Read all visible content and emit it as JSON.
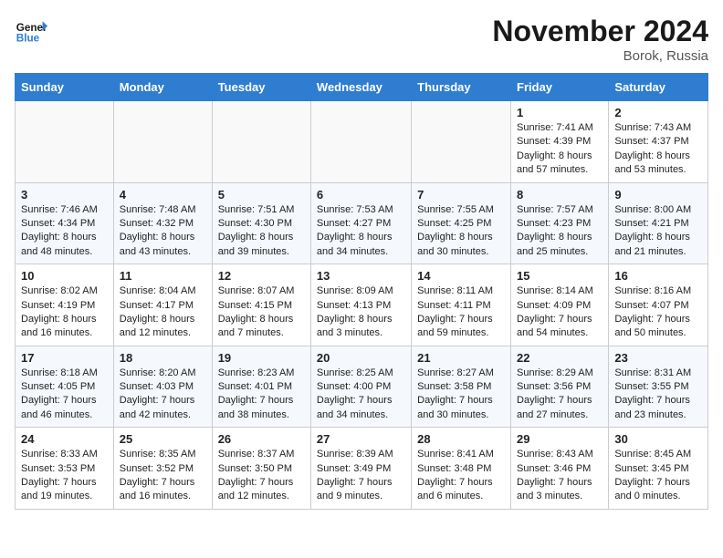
{
  "header": {
    "logo_general": "General",
    "logo_blue": "Blue",
    "month_title": "November 2024",
    "location": "Borok, Russia"
  },
  "days_of_week": [
    "Sunday",
    "Monday",
    "Tuesday",
    "Wednesday",
    "Thursday",
    "Friday",
    "Saturday"
  ],
  "weeks": [
    [
      {
        "day": "",
        "info": ""
      },
      {
        "day": "",
        "info": ""
      },
      {
        "day": "",
        "info": ""
      },
      {
        "day": "",
        "info": ""
      },
      {
        "day": "",
        "info": ""
      },
      {
        "day": "1",
        "info": "Sunrise: 7:41 AM\nSunset: 4:39 PM\nDaylight: 8 hours and 57 minutes."
      },
      {
        "day": "2",
        "info": "Sunrise: 7:43 AM\nSunset: 4:37 PM\nDaylight: 8 hours and 53 minutes."
      }
    ],
    [
      {
        "day": "3",
        "info": "Sunrise: 7:46 AM\nSunset: 4:34 PM\nDaylight: 8 hours and 48 minutes."
      },
      {
        "day": "4",
        "info": "Sunrise: 7:48 AM\nSunset: 4:32 PM\nDaylight: 8 hours and 43 minutes."
      },
      {
        "day": "5",
        "info": "Sunrise: 7:51 AM\nSunset: 4:30 PM\nDaylight: 8 hours and 39 minutes."
      },
      {
        "day": "6",
        "info": "Sunrise: 7:53 AM\nSunset: 4:27 PM\nDaylight: 8 hours and 34 minutes."
      },
      {
        "day": "7",
        "info": "Sunrise: 7:55 AM\nSunset: 4:25 PM\nDaylight: 8 hours and 30 minutes."
      },
      {
        "day": "8",
        "info": "Sunrise: 7:57 AM\nSunset: 4:23 PM\nDaylight: 8 hours and 25 minutes."
      },
      {
        "day": "9",
        "info": "Sunrise: 8:00 AM\nSunset: 4:21 PM\nDaylight: 8 hours and 21 minutes."
      }
    ],
    [
      {
        "day": "10",
        "info": "Sunrise: 8:02 AM\nSunset: 4:19 PM\nDaylight: 8 hours and 16 minutes."
      },
      {
        "day": "11",
        "info": "Sunrise: 8:04 AM\nSunset: 4:17 PM\nDaylight: 8 hours and 12 minutes."
      },
      {
        "day": "12",
        "info": "Sunrise: 8:07 AM\nSunset: 4:15 PM\nDaylight: 8 hours and 7 minutes."
      },
      {
        "day": "13",
        "info": "Sunrise: 8:09 AM\nSunset: 4:13 PM\nDaylight: 8 hours and 3 minutes."
      },
      {
        "day": "14",
        "info": "Sunrise: 8:11 AM\nSunset: 4:11 PM\nDaylight: 7 hours and 59 minutes."
      },
      {
        "day": "15",
        "info": "Sunrise: 8:14 AM\nSunset: 4:09 PM\nDaylight: 7 hours and 54 minutes."
      },
      {
        "day": "16",
        "info": "Sunrise: 8:16 AM\nSunset: 4:07 PM\nDaylight: 7 hours and 50 minutes."
      }
    ],
    [
      {
        "day": "17",
        "info": "Sunrise: 8:18 AM\nSunset: 4:05 PM\nDaylight: 7 hours and 46 minutes."
      },
      {
        "day": "18",
        "info": "Sunrise: 8:20 AM\nSunset: 4:03 PM\nDaylight: 7 hours and 42 minutes."
      },
      {
        "day": "19",
        "info": "Sunrise: 8:23 AM\nSunset: 4:01 PM\nDaylight: 7 hours and 38 minutes."
      },
      {
        "day": "20",
        "info": "Sunrise: 8:25 AM\nSunset: 4:00 PM\nDaylight: 7 hours and 34 minutes."
      },
      {
        "day": "21",
        "info": "Sunrise: 8:27 AM\nSunset: 3:58 PM\nDaylight: 7 hours and 30 minutes."
      },
      {
        "day": "22",
        "info": "Sunrise: 8:29 AM\nSunset: 3:56 PM\nDaylight: 7 hours and 27 minutes."
      },
      {
        "day": "23",
        "info": "Sunrise: 8:31 AM\nSunset: 3:55 PM\nDaylight: 7 hours and 23 minutes."
      }
    ],
    [
      {
        "day": "24",
        "info": "Sunrise: 8:33 AM\nSunset: 3:53 PM\nDaylight: 7 hours and 19 minutes."
      },
      {
        "day": "25",
        "info": "Sunrise: 8:35 AM\nSunset: 3:52 PM\nDaylight: 7 hours and 16 minutes."
      },
      {
        "day": "26",
        "info": "Sunrise: 8:37 AM\nSunset: 3:50 PM\nDaylight: 7 hours and 12 minutes."
      },
      {
        "day": "27",
        "info": "Sunrise: 8:39 AM\nSunset: 3:49 PM\nDaylight: 7 hours and 9 minutes."
      },
      {
        "day": "28",
        "info": "Sunrise: 8:41 AM\nSunset: 3:48 PM\nDaylight: 7 hours and 6 minutes."
      },
      {
        "day": "29",
        "info": "Sunrise: 8:43 AM\nSunset: 3:46 PM\nDaylight: 7 hours and 3 minutes."
      },
      {
        "day": "30",
        "info": "Sunrise: 8:45 AM\nSunset: 3:45 PM\nDaylight: 7 hours and 0 minutes."
      }
    ]
  ]
}
